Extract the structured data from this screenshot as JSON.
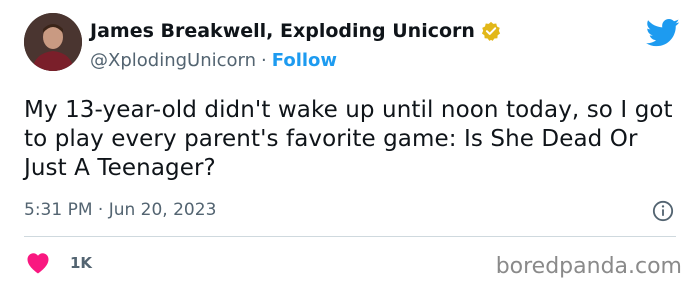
{
  "author": {
    "display_name": "James Breakwell, Exploding Unicorn",
    "handle": "@XplodingUnicorn",
    "separator": "·",
    "follow_label": "Follow",
    "verified_badge_color": "#e2b719"
  },
  "tweet": {
    "text": "My 13-year-old didn't wake up until noon today, so I got to play every parent's favorite game: Is She Dead Or Just A Teenager?",
    "timestamp": "5:31 PM · Jun 20, 2023"
  },
  "engagement": {
    "likes": "1K",
    "heart_color": "#f91880"
  },
  "watermark": "boredpanda.com",
  "colors": {
    "link": "#1d9bf0",
    "muted": "#536471",
    "text": "#0f1419",
    "divider": "#cfd9de"
  },
  "icons": {
    "platform_logo": "twitter-bird-icon",
    "info": "info-icon",
    "like": "heart-icon",
    "verified": "verified-badge-icon"
  }
}
